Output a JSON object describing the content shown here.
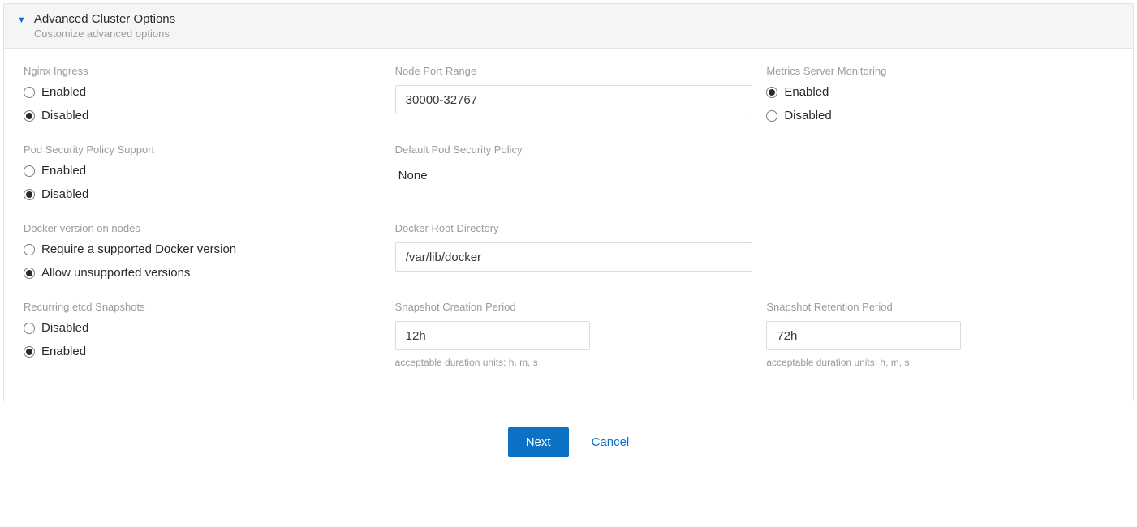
{
  "panel": {
    "title": "Advanced Cluster Options",
    "subtitle": "Customize advanced options"
  },
  "labels": {
    "enabled": "Enabled",
    "disabled": "Disabled"
  },
  "nginx_ingress": {
    "label": "Nginx Ingress",
    "selected": "Disabled"
  },
  "node_port_range": {
    "label": "Node Port Range",
    "value": "30000-32767"
  },
  "metrics_server": {
    "label": "Metrics Server Monitoring",
    "selected": "Enabled"
  },
  "pod_security_policy": {
    "label": "Pod Security Policy Support",
    "selected": "Disabled"
  },
  "default_pod_security_policy": {
    "label": "Default Pod Security Policy",
    "value": "None"
  },
  "docker_version": {
    "label": "Docker version on nodes",
    "option_require": "Require a supported Docker version",
    "option_allow": "Allow unsupported versions",
    "selected": "Allow unsupported versions"
  },
  "docker_root_dir": {
    "label": "Docker Root Directory",
    "value": "/var/lib/docker"
  },
  "recurring_etcd": {
    "label": "Recurring etcd Snapshots",
    "selected": "Enabled"
  },
  "snapshot_creation": {
    "label": "Snapshot Creation Period",
    "value": "12h",
    "helper": "acceptable duration units: h, m, s"
  },
  "snapshot_retention": {
    "label": "Snapshot Retention Period",
    "value": "72h",
    "helper": "acceptable duration units: h, m, s"
  },
  "actions": {
    "next": "Next",
    "cancel": "Cancel"
  }
}
